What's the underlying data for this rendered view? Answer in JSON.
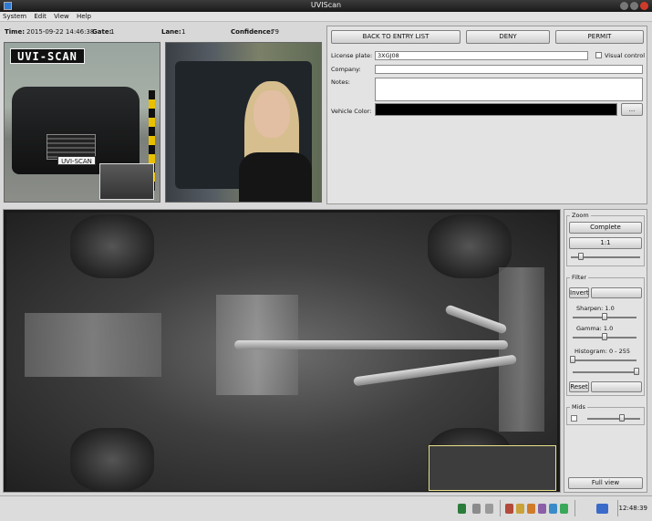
{
  "window": {
    "title": "UVIScan"
  },
  "menu": {
    "items": [
      "System",
      "Edit",
      "View",
      "Help"
    ]
  },
  "info": {
    "time_label": "Time:",
    "time_value": "2015-09-22 14:46:38",
    "gate_label": "Gate:",
    "gate_value": "1",
    "lane_label": "Lane:",
    "lane_value": "1",
    "confidence_label": "Confidence:",
    "confidence_value": "79"
  },
  "photos": {
    "sign_text": "UVI-SCAN",
    "car_plate_text": "UVI-SCAN"
  },
  "details": {
    "back_button": "BACK TO ENTRY LIST",
    "deny_button": "DENY",
    "permit_button": "PERMIT",
    "license_plate_label": "License plate:",
    "license_plate_value": "3XGJ08",
    "visual_control_label": "Visual control",
    "company_label": "Company:",
    "company_value": "",
    "notes_label": "Notes:",
    "notes_value": "",
    "vehicle_color_label": "Vehicle Color:",
    "vehicle_color_hex": "#000000",
    "color_picker_button": "..."
  },
  "zoom": {
    "title": "Zoom",
    "complete_button": "Complete",
    "one_to_one_button": "1:1",
    "zoom_level": 0.15
  },
  "filter": {
    "title": "Filter",
    "invert_button": "Invert",
    "sharpen_label": "Sharpen: 1.0",
    "sharpen_value": 0.5,
    "gamma_label": "Gamma: 1.0",
    "gamma_value": 0.5,
    "histogram_label": "Histogram: 0 - 255",
    "histogram_low": 0,
    "histogram_high": 255,
    "reset_button": "Reset"
  },
  "mids": {
    "title": "Mids",
    "level": 0.65
  },
  "full_view_button": "Full view",
  "status": {
    "clock": "12:48:39",
    "icons": [
      "camera-icon",
      "printer-icon",
      "drive-icon",
      "scanner-icon",
      "signal-icon",
      "folder-icon",
      "lock-icon",
      "settings-icon",
      "network-icon",
      "monitor-icon"
    ]
  }
}
